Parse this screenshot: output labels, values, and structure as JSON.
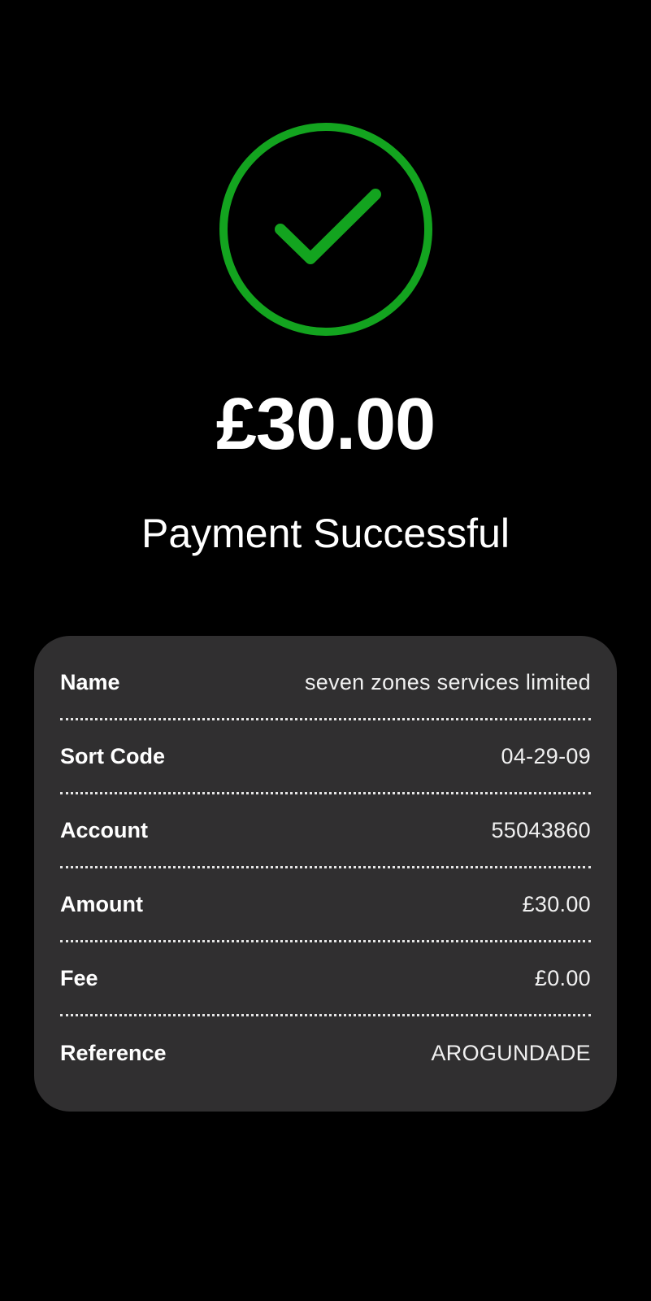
{
  "icons": {
    "success": "check-circle-icon"
  },
  "colors": {
    "background": "#000000",
    "accent_green": "#13a41f",
    "card_background": "#302f30",
    "text": "#ffffff"
  },
  "payment": {
    "amount": "£30.00",
    "status": "Payment Successful"
  },
  "details": {
    "name": {
      "label": "Name",
      "value": "seven zones services limited"
    },
    "sort_code": {
      "label": "Sort Code",
      "value": "04-29-09"
    },
    "account": {
      "label": "Account",
      "value": "55043860"
    },
    "amount": {
      "label": "Amount",
      "value": "£30.00"
    },
    "fee": {
      "label": "Fee",
      "value": "£0.00"
    },
    "reference": {
      "label": "Reference",
      "value": "AROGUNDADE"
    }
  }
}
